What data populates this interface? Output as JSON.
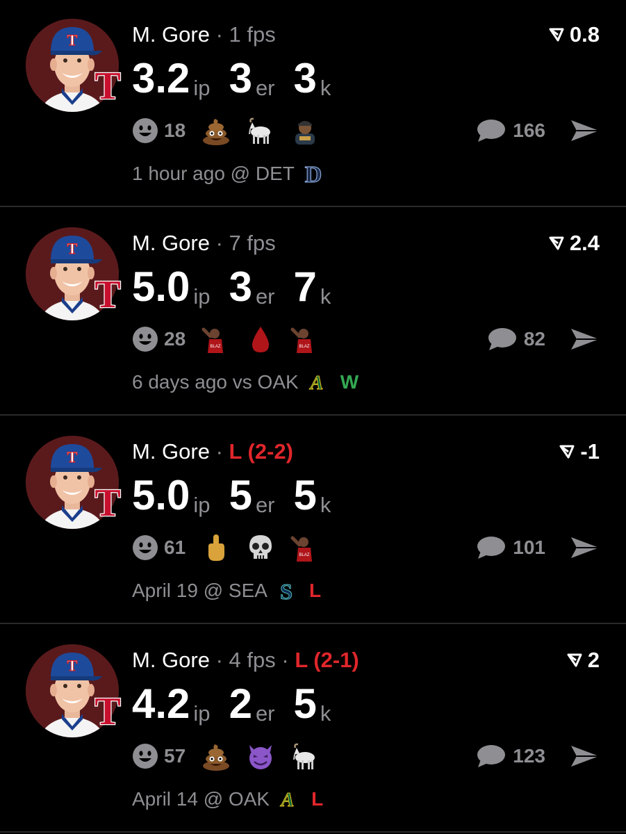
{
  "colors": {
    "background": "#000000",
    "muted": "#8e8e93",
    "loss": "#e0262b",
    "win": "#34a853",
    "divider": "#2a2a2a"
  },
  "posts": [
    {
      "player": "M. Gore",
      "fps": "1 fps",
      "record": "",
      "score": "0.8",
      "ip": "3.2",
      "ip_unit": "ip",
      "er": "3",
      "er_unit": "er",
      "k": "3",
      "k_unit": "k",
      "reaction_count": "18",
      "reactions": [
        "poop-emoji",
        "goat-emoji",
        "person-sticker"
      ],
      "comments": "166",
      "time": "1 hour ago @ DET",
      "opponent_logo": "tigers-logo",
      "result": ""
    },
    {
      "player": "M. Gore",
      "fps": "7 fps",
      "record": "",
      "score": "2.4",
      "ip": "5.0",
      "ip_unit": "ip",
      "er": "3",
      "er_unit": "er",
      "k": "7",
      "k_unit": "k",
      "reaction_count": "28",
      "reactions": [
        "player-sticker",
        "blood-drop-emoji",
        "player-sticker"
      ],
      "comments": "82",
      "time": "6 days ago vs OAK",
      "opponent_logo": "athletics-logo",
      "result": "W"
    },
    {
      "player": "M. Gore",
      "fps": "",
      "record": "L (2-2)",
      "score": "-1",
      "ip": "5.0",
      "ip_unit": "ip",
      "er": "5",
      "er_unit": "er",
      "k": "5",
      "k_unit": "k",
      "reaction_count": "61",
      "reactions": [
        "middle-finger-emoji",
        "skull-emoji",
        "player-sticker"
      ],
      "comments": "101",
      "time": "April 19 @ SEA",
      "opponent_logo": "mariners-logo",
      "result": "L"
    },
    {
      "player": "M. Gore",
      "fps": "4 fps",
      "record": "L (2-1)",
      "score": "2",
      "ip": "4.2",
      "ip_unit": "ip",
      "er": "2",
      "er_unit": "er",
      "k": "5",
      "k_unit": "k",
      "reaction_count": "57",
      "reactions": [
        "poop-emoji",
        "smiling-devil-emoji",
        "goat-emoji"
      ],
      "comments": "123",
      "time": "April 14 @ OAK",
      "opponent_logo": "athletics-logo",
      "result": "L"
    }
  ]
}
